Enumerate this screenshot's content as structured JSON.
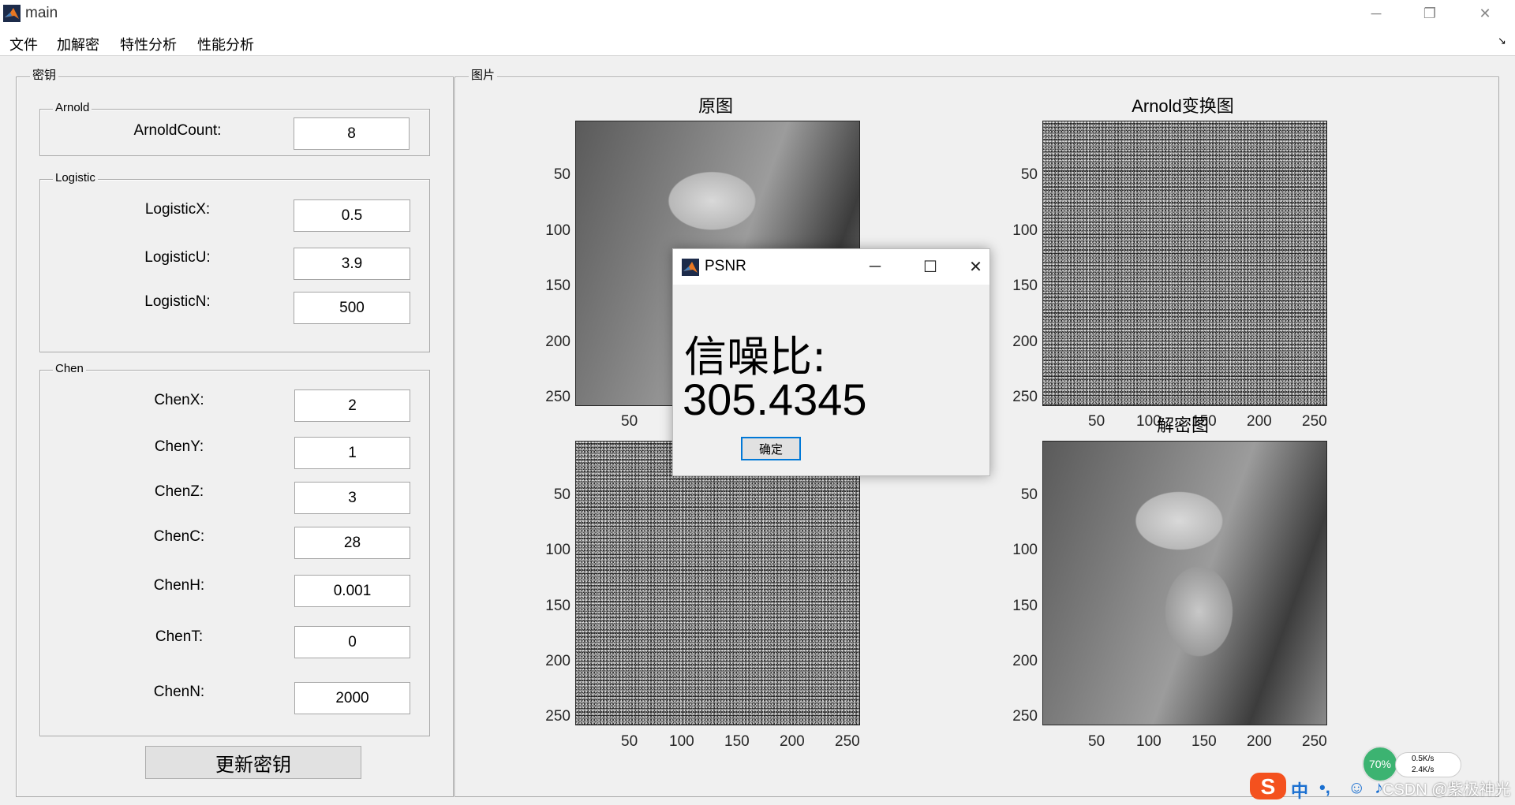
{
  "window": {
    "title": "main",
    "app_icon": "matlab-icon"
  },
  "menu": [
    "文件",
    "加解密",
    "特性分析",
    "性能分析"
  ],
  "key_panel": {
    "title": "密钥",
    "arnold": {
      "title": "Arnold",
      "fields": [
        {
          "label": "ArnoldCount:",
          "value": "8"
        }
      ]
    },
    "logistic": {
      "title": "Logistic",
      "fields": [
        {
          "label": "LogisticX:",
          "value": "0.5"
        },
        {
          "label": "LogisticU:",
          "value": "3.9"
        },
        {
          "label": "LogisticN:",
          "value": "500"
        }
      ]
    },
    "chen": {
      "title": "Chen",
      "fields": [
        {
          "label": "ChenX:",
          "value": "2"
        },
        {
          "label": "ChenY:",
          "value": "1"
        },
        {
          "label": "ChenZ:",
          "value": "3"
        },
        {
          "label": "ChenC:",
          "value": "28"
        },
        {
          "label": "ChenH:",
          "value": "0.001"
        },
        {
          "label": "ChenT:",
          "value": "0"
        },
        {
          "label": "ChenN:",
          "value": "2000"
        }
      ]
    },
    "update_button": "更新密钥"
  },
  "image_panel": {
    "title": "图片",
    "axes": [
      {
        "title": "原图",
        "content": "photo"
      },
      {
        "title": "Arnold变换图",
        "content": "noise"
      },
      {
        "title": "",
        "content": "noise"
      },
      {
        "title": "解密图",
        "content": "photo"
      }
    ],
    "y_ticks": [
      "50",
      "100",
      "150",
      "200",
      "250"
    ],
    "x_ticks": [
      "50",
      "100",
      "150",
      "200",
      "250"
    ]
  },
  "dialog": {
    "title": "PSNR",
    "line1": "信噪比:",
    "line2": "305.4345",
    "ok": "确定"
  },
  "taskbar": {
    "cpu": "70%",
    "up": "0.5K/s",
    "down": "2.4K/s",
    "ime": "中",
    "punct": "•,",
    "watermark": "CSDN @紫极神光"
  }
}
